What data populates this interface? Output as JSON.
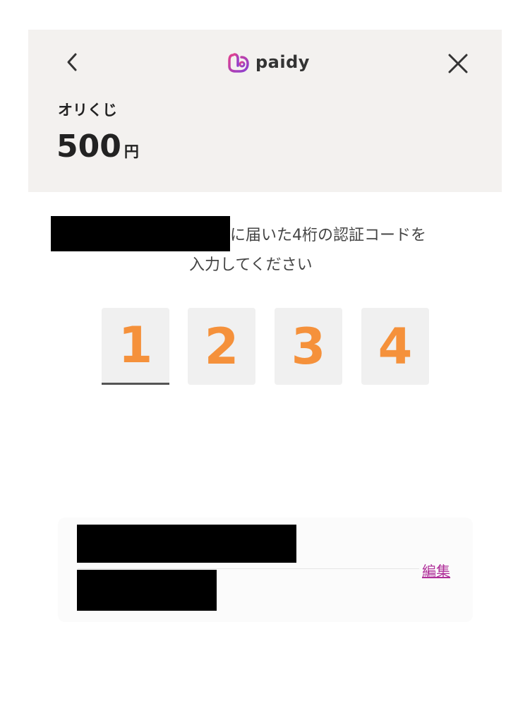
{
  "header": {
    "logo": {
      "icon": "paidy-logo-icon",
      "text": "paidy",
      "color": "#c53fa8"
    },
    "back_icon": "chevron-left-icon",
    "close_icon": "close-icon",
    "merchant_name": "オリくじ",
    "amount_value": "500",
    "amount_unit": "円"
  },
  "verification": {
    "instruction_line1": "に届いた4桁の認証コードを",
    "instruction_line2": "入力してください",
    "code_digits": [
      "1",
      "2",
      "3",
      "4"
    ],
    "digit_color": "#f5913b"
  },
  "contact_card": {
    "edit_label": "編集",
    "link_color": "#b0309a"
  }
}
